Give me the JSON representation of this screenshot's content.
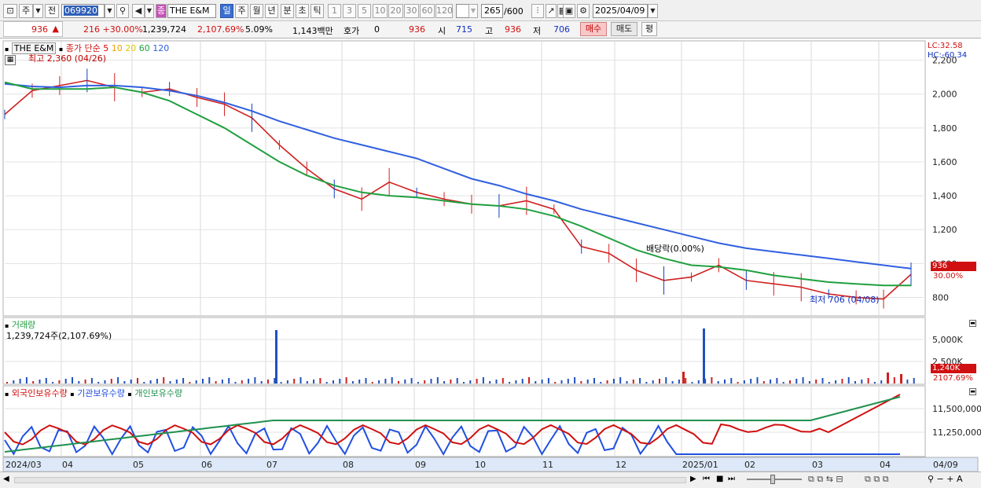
{
  "toolbar": {
    "period_select": "주",
    "prev_label": "전",
    "stock_code": "069920",
    "stock_badge": "종",
    "stock_name": "THE E&M",
    "periods": [
      "일",
      "주",
      "월",
      "년",
      "분",
      "초",
      "틱"
    ],
    "intervals": [
      "1",
      "3",
      "5",
      "10",
      "20",
      "30",
      "60",
      "120"
    ],
    "count": "265",
    "count_total": "/600",
    "date": "2025/04/09"
  },
  "quote": {
    "price": "936",
    "arrow": "▲",
    "change": "216 +30.00%",
    "volume": "1,239,724",
    "volume_ratio": "2,107.69%",
    "turnover_rate": "5.09%",
    "amount": "1,143백만",
    "hoga_label": "호가",
    "hoga_value": "0",
    "hoga_price": "936",
    "open_label": "시",
    "open": "715",
    "high_label": "고",
    "high": "936",
    "low_label": "저",
    "low": "706",
    "buy_label": "매수",
    "sell_label": "매도",
    "avg_label": "평"
  },
  "price_panel": {
    "name": "THE E&M",
    "ma_label": "종가 단순",
    "ma_periods": [
      "5",
      "10",
      "20",
      "60",
      "120"
    ],
    "ma_colors": [
      "#e00000",
      "#f0a000",
      "#f0e000",
      "#20a040",
      "#3060e0"
    ],
    "high_note": "최고 2,360 (04/26)",
    "low_note": "최저 706 (04/08)",
    "dividend_note": "배당락(0.00%)",
    "lc": "LC:32.58",
    "hc": "HC:-60.34",
    "price_tag": "936",
    "pct_tag": "30.00%",
    "y_ticks": [
      "2,200",
      "2,000",
      "1,800",
      "1,600",
      "1,400",
      "1,200",
      "1,000",
      "800"
    ]
  },
  "volume_panel": {
    "title": "거래량",
    "value": "1,239,724주(2,107.69%)",
    "y_ticks": [
      "5,000K",
      "2,500K"
    ],
    "tag": "1,240K",
    "tag_pct": "2107.69%"
  },
  "holding_panel": {
    "series": [
      {
        "name": "외국인보유수량",
        "color": "#d01010"
      },
      {
        "name": "기관보유수량",
        "color": "#2050e0"
      },
      {
        "name": "개인보유수량",
        "color": "#209050"
      }
    ],
    "y_ticks": [
      "11,500,000",
      "11,250,000"
    ]
  },
  "x_axis": {
    "labels": [
      "2024/03",
      "04",
      "05",
      "06",
      "07",
      "08",
      "09",
      "10",
      "11",
      "12",
      "2025/01",
      "02",
      "03",
      "04"
    ],
    "end_label": "04/09"
  },
  "chart_data": {
    "type": "line",
    "title": "THE E&M",
    "series": [
      {
        "name": "종가",
        "color": "#d02020",
        "values": [
          1880,
          2020,
          2050,
          2080,
          2040,
          2010,
          2030,
          1980,
          1940,
          1860,
          1700,
          1560,
          1440,
          1380,
          1480,
          1420,
          1380,
          1350,
          1340,
          1370,
          1320,
          1100,
          1060,
          960,
          900,
          920,
          990,
          900,
          880,
          860,
          820,
          800,
          790,
          936
        ]
      },
      {
        "name": "MA120",
        "color": "#3060e0",
        "values": [
          2060,
          2045,
          2040,
          2050,
          2050,
          2040,
          2020,
          1990,
          1950,
          1900,
          1840,
          1790,
          1740,
          1700,
          1660,
          1620,
          1560,
          1500,
          1460,
          1410,
          1370,
          1320,
          1280,
          1240,
          1200,
          1160,
          1120,
          1090,
          1070,
          1050,
          1030,
          1010,
          990,
          970
        ]
      },
      {
        "name": "MA60",
        "color": "#20a040",
        "values": [
          2070,
          2030,
          2030,
          2030,
          2040,
          2010,
          1960,
          1880,
          1800,
          1700,
          1600,
          1520,
          1460,
          1420,
          1400,
          1390,
          1370,
          1350,
          1340,
          1320,
          1280,
          1220,
          1150,
          1080,
          1030,
          990,
          980,
          960,
          930,
          910,
          890,
          880,
          870,
          870
        ]
      }
    ],
    "ylim": [
      700,
      2300
    ]
  }
}
